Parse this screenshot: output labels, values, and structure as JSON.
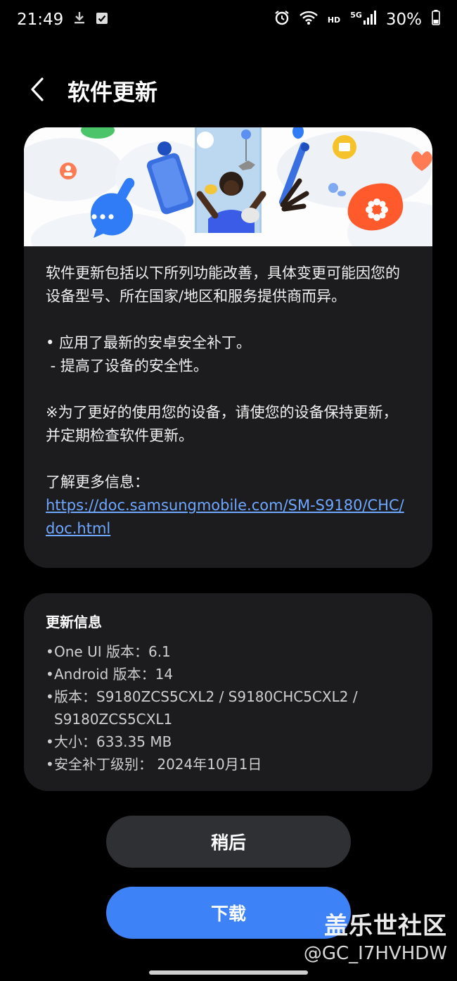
{
  "status_bar": {
    "time": "21:49",
    "hd": "HD",
    "network": "5G",
    "battery": "30%"
  },
  "header": {
    "title": "软件更新"
  },
  "notes": {
    "intro": "软件更新包括以下所列功能改善，具体变更可能因您的设备型号、所在国家/地区和服务提供商而异。",
    "item_1": "• 应用了最新的安卓安全补丁。",
    "item_1_sub": " - 提高了设备的安全性。",
    "reminder": "※为了更好的使用您的设备，请使您的设备保持更新，并定期检查软件更新。",
    "more_info": "了解更多信息：",
    "link": "https://doc.samsungmobile.com/SM-S9180/CHC/doc.html"
  },
  "update_info": {
    "title": "更新信息",
    "items": [
      "One UI 版本：6.1",
      "Android 版本：14",
      "版本：S9180ZCS5CXL2 / S9180CHC5CXL2 / S9180ZCS5CXL1",
      "大小：633.35 MB",
      "安全补丁级别： 2024年10月1日"
    ]
  },
  "buttons": {
    "later": "稍后",
    "download": "下载"
  },
  "watermark": {
    "line1": "盖乐世社区",
    "line2": "@GC_I7HVHDW"
  },
  "colors": {
    "accent": "#3e82f7",
    "card": "#1c1c1e",
    "link": "#6ea7ff"
  }
}
